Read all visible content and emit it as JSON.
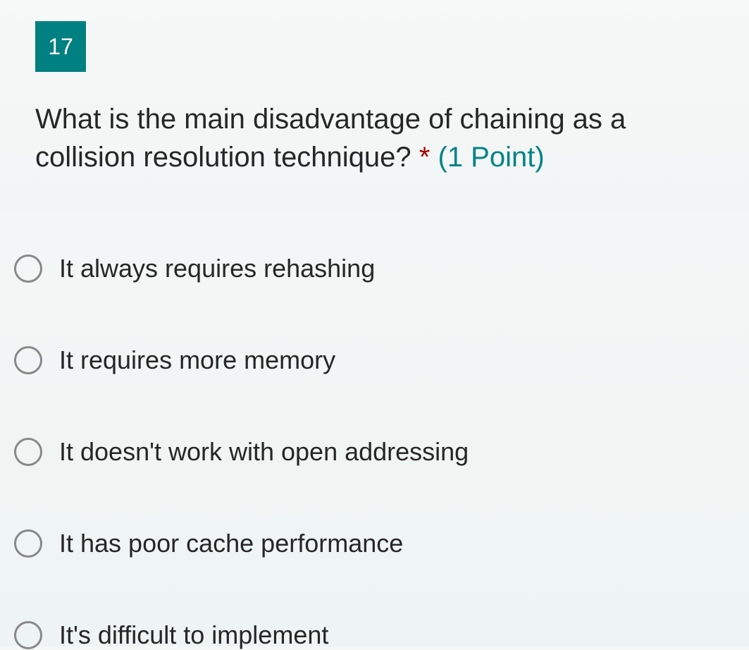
{
  "question": {
    "number": "17",
    "text": "What is the main disadvantage of chaining as a collision resolution technique?",
    "required_marker": "*",
    "points_label": "(1 Point)"
  },
  "options": [
    {
      "label": "It always requires rehashing"
    },
    {
      "label": "It requires more memory"
    },
    {
      "label": "It doesn't work with open addressing"
    },
    {
      "label": "It has poor cache performance"
    },
    {
      "label": "It's difficult to implement"
    }
  ],
  "colors": {
    "accent": "#008080",
    "required": "#a80000",
    "points": "#038387"
  }
}
